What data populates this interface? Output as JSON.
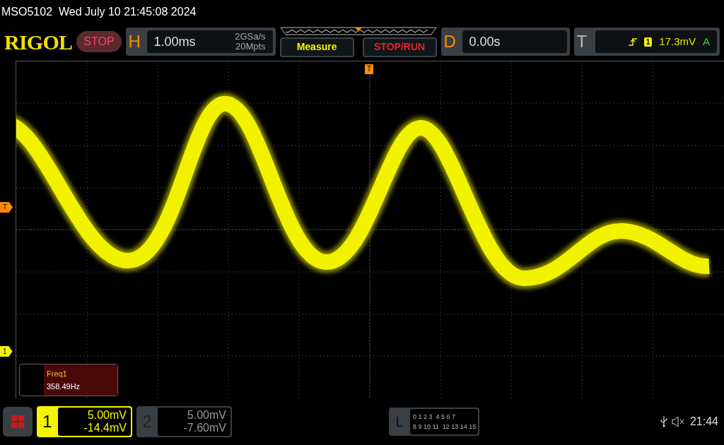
{
  "title_bar": {
    "text": "MSO5102  Wed July 10 21:45:08 2024"
  },
  "header": {
    "logo": "RIGOL",
    "run_state": "STOP",
    "horizontal": {
      "letter": "H",
      "timebase": "1.00ms",
      "sample_rate": "2GSa/s",
      "memory_depth": "20Mpts"
    },
    "buttons": [
      {
        "label": "Measure",
        "kind": "measure"
      },
      {
        "label": "STOP/RUN",
        "kind": "run"
      }
    ],
    "delay": {
      "letter": "D",
      "value": "0.00s"
    },
    "trigger": {
      "letter": "T",
      "source": "1",
      "level": "17.3mV",
      "mode": "A"
    }
  },
  "display": {
    "top_marker": "T",
    "trigger_marker": "T",
    "channel_marker": "1",
    "measurement": {
      "name": "Freq1",
      "value": "358.49Hz"
    }
  },
  "bottom_bar": {
    "channels": [
      {
        "number": "1",
        "scale": "5.00mV",
        "offset": "-14.4mV",
        "selected": true
      },
      {
        "number": "2",
        "scale": "5.00mV",
        "offset": "-7.60mV",
        "selected": false
      }
    ],
    "logic": {
      "letter": "L",
      "row_1": [
        "0 1 2 3",
        "4 5 6 7"
      ],
      "row_2": [
        "8 9 10 11",
        "12 13 14 15"
      ]
    },
    "time": "21:44"
  }
}
